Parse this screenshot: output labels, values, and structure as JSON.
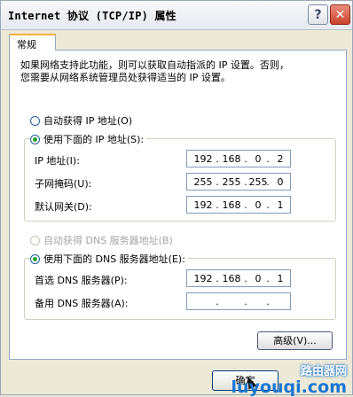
{
  "window": {
    "title": "Internet 协议 (TCP/IP) 属性"
  },
  "titlebar_buttons": {
    "help": "?",
    "close": "✕"
  },
  "tabs": [
    {
      "label": "常规"
    }
  ],
  "description_line1": "如果网络支持此功能，则可以获取自动指派的 IP 设置。否则，",
  "description_line2": "您需要从网络系统管理员处获得适当的 IP 设置。",
  "ip_section": {
    "auto_option": "自动获得 IP 地址(O)",
    "manual_option": "使用下面的 IP 地址(S):",
    "selected": "manual",
    "fields": [
      {
        "label": "IP 地址(I):",
        "octets": [
          "192",
          "168",
          "0",
          "2"
        ]
      },
      {
        "label": "子网掩码(U):",
        "octets": [
          "255",
          "255",
          "255",
          "0"
        ]
      },
      {
        "label": "默认网关(D):",
        "octets": [
          "192",
          "168",
          "0",
          "1"
        ]
      }
    ]
  },
  "dns_section": {
    "auto_option": "自动获得 DNS 服务器地址(B)",
    "manual_option": "使用下面的 DNS 服务器地址(E):",
    "selected": "manual",
    "fields": [
      {
        "label": "首选 DNS 服务器(P):",
        "octets": [
          "192",
          "168",
          "0",
          "1"
        ]
      },
      {
        "label": "备用 DNS 服务器(A):",
        "octets": [
          "",
          "",
          "",
          ""
        ]
      }
    ]
  },
  "buttons": {
    "advanced": "高级(V)...",
    "ok": "确定"
  },
  "watermark": {
    "text_cn": "路由器网",
    "text_en": "luyouqi.com"
  },
  "colors": {
    "radio_selected": "#29a32b",
    "close_button": "#c9412b",
    "tab_highlight": "#f1b23a"
  }
}
